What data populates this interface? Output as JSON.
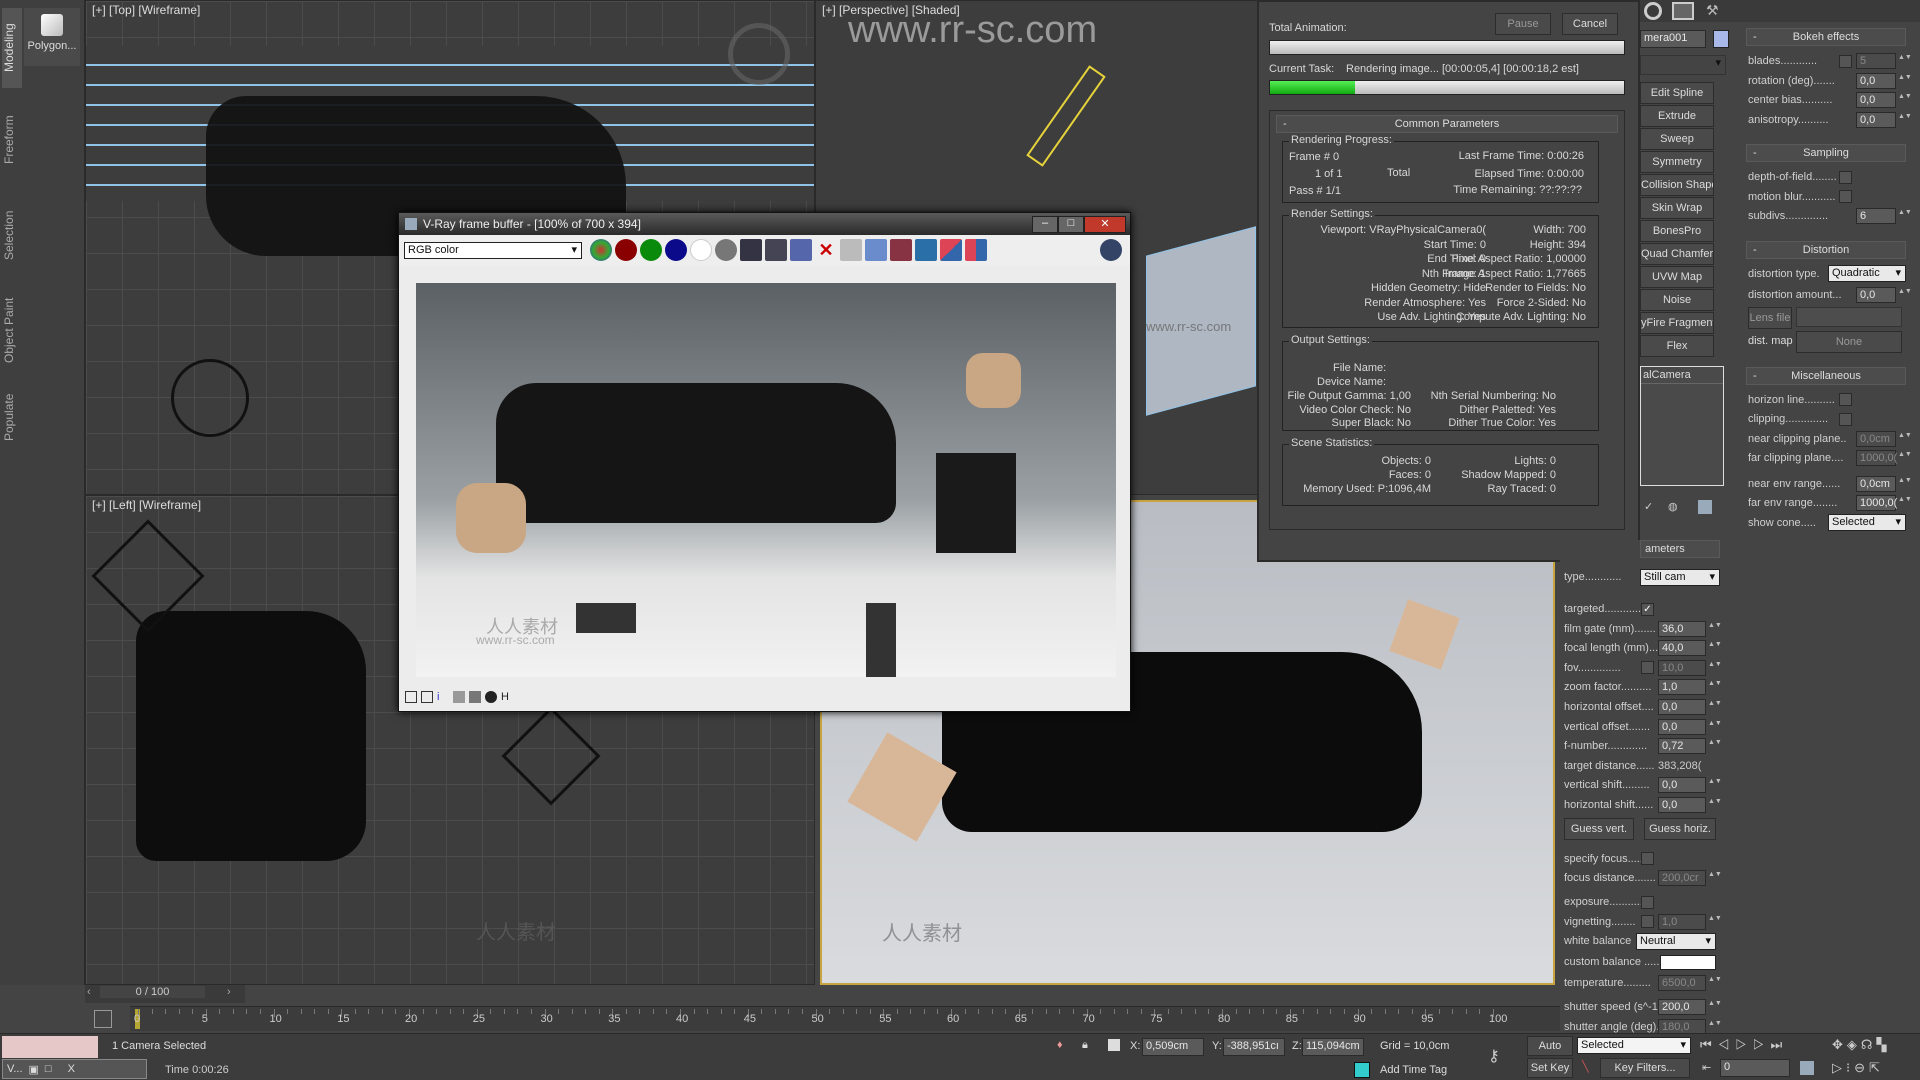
{
  "ribbon": {
    "tabs": [
      "Modeling",
      "Freeform",
      "Selection",
      "Object Paint",
      "Populate"
    ],
    "polygon_label": "Polygon..."
  },
  "viewports": {
    "top": "[+] [Top] [Wireframe]",
    "left": "[+] [Left] [Wireframe]",
    "perspective": "[+] [Perspective] [Shaded]",
    "watermark": "www.rr-sc.com",
    "watermark_small": "人人素材",
    "watermark_url": "www.rr-sc.com"
  },
  "render_dialog": {
    "total_animation": "Total Animation:",
    "pause": "Pause",
    "cancel": "Cancel",
    "current_task_label": "Current Task:",
    "current_task": "Rendering image... [00:00:05,4] [00:00:18,2 est]",
    "total_progress": 0,
    "task_progress": 24,
    "common_parameters": "Common Parameters",
    "rendering_progress": {
      "title": "Rendering Progress:",
      "frame": "Frame #  0",
      "of": "1 of 1",
      "total": "Total",
      "pass": "Pass #  1/1",
      "last_frame_time": "Last Frame Time:  0:00:26",
      "elapsed_time": "Elapsed Time:  0:00:00",
      "time_remaining": "Time Remaining: ??:??:??"
    },
    "render_settings": {
      "title": "Render Settings:",
      "left": [
        "Viewport: VRayPhysicalCamera0(",
        "Start Time: 0",
        "End Time: 0",
        "Nth Frame: 1",
        "Hidden Geometry: Hide",
        "Render Atmosphere: Yes",
        "Use Adv. Lighting: Yes"
      ],
      "right": [
        "Width: 700",
        "Height: 394",
        "Pixel Aspect Ratio: 1,00000",
        "Image Aspect Ratio: 1,77665",
        "Render to Fields: No",
        "Force 2-Sided: No",
        "Compute Adv. Lighting: No"
      ]
    },
    "output_settings": {
      "title": "Output Settings:",
      "file_name": "File Name:",
      "device_name": "Device Name:",
      "left": [
        "File Output Gamma: 1,00",
        "Video Color Check: No",
        "Super Black: No"
      ],
      "right": [
        "Nth Serial Numbering: No",
        "Dither Paletted: Yes",
        "Dither True Color: Yes"
      ]
    },
    "scene_statistics": {
      "title": "Scene Statistics:",
      "left": [
        "Objects: 0",
        "Faces: 0",
        "Memory Used: P:1096,4M"
      ],
      "right": [
        "Lights: 0",
        "Shadow Mapped: 0",
        "Ray Traced: 0"
      ]
    }
  },
  "vfb": {
    "title": "V-Ray frame buffer - [100% of 700 x 394]",
    "channel": "RGB color",
    "colors": {
      "red": "#8a0000",
      "green": "#0a8a0a",
      "blue": "#0a0a8a"
    }
  },
  "modifier_panel": {
    "object_name": "mera001",
    "object_color": "#a8b8e8",
    "buttons": [
      "Edit Spline",
      "Extrude",
      "Sweep",
      "Symmetry",
      "Collision Shape",
      "Skin Wrap",
      "BonesPro",
      "Quad Chamfer",
      "UVW Map",
      "Noise",
      "yFire Fragment",
      "Flex"
    ],
    "stack_item": "alCamera"
  },
  "camera_params": {
    "header": "ameters",
    "type_label": "type............",
    "type_value": "Still cam",
    "rows": [
      {
        "label": "targeted..............",
        "check": true
      },
      {
        "label": "film gate (mm).......",
        "value": "36,0"
      },
      {
        "label": "focal length (mm)....",
        "value": "40,0"
      },
      {
        "label": "fov..............",
        "check": false,
        "value": "10,0",
        "dim": true
      },
      {
        "label": "zoom factor..........",
        "value": "1,0"
      },
      {
        "label": "horizontal offset....",
        "value": "0,0"
      },
      {
        "label": "vertical offset.......",
        "value": "0,0"
      },
      {
        "label": "f-number.............",
        "value": "0,72"
      },
      {
        "label": "target distance......",
        "text": "383,208("
      },
      {
        "label": "vertical shift.........",
        "value": "0,0"
      },
      {
        "label": "horizontal shift......",
        "value": "0,0"
      }
    ],
    "guess_vert": "Guess vert.",
    "guess_horiz": "Guess horiz.",
    "rows2": [
      {
        "label": "specify focus........",
        "check": false
      },
      {
        "label": "focus distance.......",
        "value": "200,0cr",
        "dim": true
      },
      {
        "label": "exposure.............",
        "check": false
      },
      {
        "label": "vignetting........",
        "check": false,
        "value": "1,0",
        "dim": true
      }
    ],
    "white_balance_label": "white balance",
    "white_balance": "Neutral",
    "custom_balance": "custom balance .....",
    "rows3": [
      {
        "label": "temperature.........",
        "value": "6500,0",
        "dim": true
      },
      {
        "label": "shutter speed (s^-1",
        "value": "200,0"
      },
      {
        "label": "shutter angle (deg).",
        "value": "180,0",
        "dim": true
      }
    ]
  },
  "right_panel": {
    "bokeh": {
      "title": "Bokeh effects",
      "rows": [
        {
          "label": "blades............",
          "check": false,
          "value": "5",
          "dim": true
        },
        {
          "label": "rotation (deg).......",
          "value": "0,0"
        },
        {
          "label": "center bias..........",
          "value": "0,0"
        },
        {
          "label": "anisotropy..........",
          "value": "0,0"
        }
      ]
    },
    "sampling": {
      "title": "Sampling",
      "rows": [
        {
          "label": "depth-of-field........",
          "check": false
        },
        {
          "label": "motion blur...........",
          "check": false
        },
        {
          "label": "subdivs..............",
          "value": "6"
        }
      ]
    },
    "distortion": {
      "title": "Distortion",
      "type_label": "distortion type.",
      "type_value": "Quadratic",
      "amount_label": "distortion amount...",
      "amount": "0,0",
      "lens_file": "Lens file",
      "dist_map": "dist. map",
      "none": "None"
    },
    "misc": {
      "title": "Miscellaneous",
      "rows": [
        {
          "label": "horizon line..........",
          "check": false
        },
        {
          "label": "clipping..............",
          "check": false
        },
        {
          "label": "near clipping plane..",
          "value": "0,0cm",
          "dim": true
        },
        {
          "label": "far clipping plane....",
          "value": "1000,0(",
          "dim": true
        },
        {
          "label": "near env range......",
          "value": "0,0cm"
        },
        {
          "label": "far env range........",
          "value": "1000,0("
        }
      ],
      "show_cone_label": "show cone.....",
      "show_cone": "Selected"
    }
  },
  "timeline": {
    "frame_counter": "0 / 100",
    "ticks": [
      "0",
      "5",
      "10",
      "15",
      "20",
      "25",
      "30",
      "35",
      "40",
      "45",
      "50",
      "55",
      "60",
      "65",
      "70",
      "75",
      "80",
      "85",
      "90",
      "95",
      "100"
    ]
  },
  "status": {
    "selection": "1 Camera Selected",
    "time": "Time  0:00:26",
    "taskbar_item": "V...",
    "x_label": "X:",
    "x": "0,509cm",
    "y_label": "Y:",
    "y": "-388,951cı",
    "z_label": "Z:",
    "z": "115,094cm",
    "grid": "Grid = 10,0cm",
    "add_time_tag": "Add Time Tag",
    "auto_key": "Auto Key",
    "set_key": "Set Key",
    "key_mode": "Selected",
    "key_filters": "Key Filters...",
    "current_frame": "0"
  }
}
